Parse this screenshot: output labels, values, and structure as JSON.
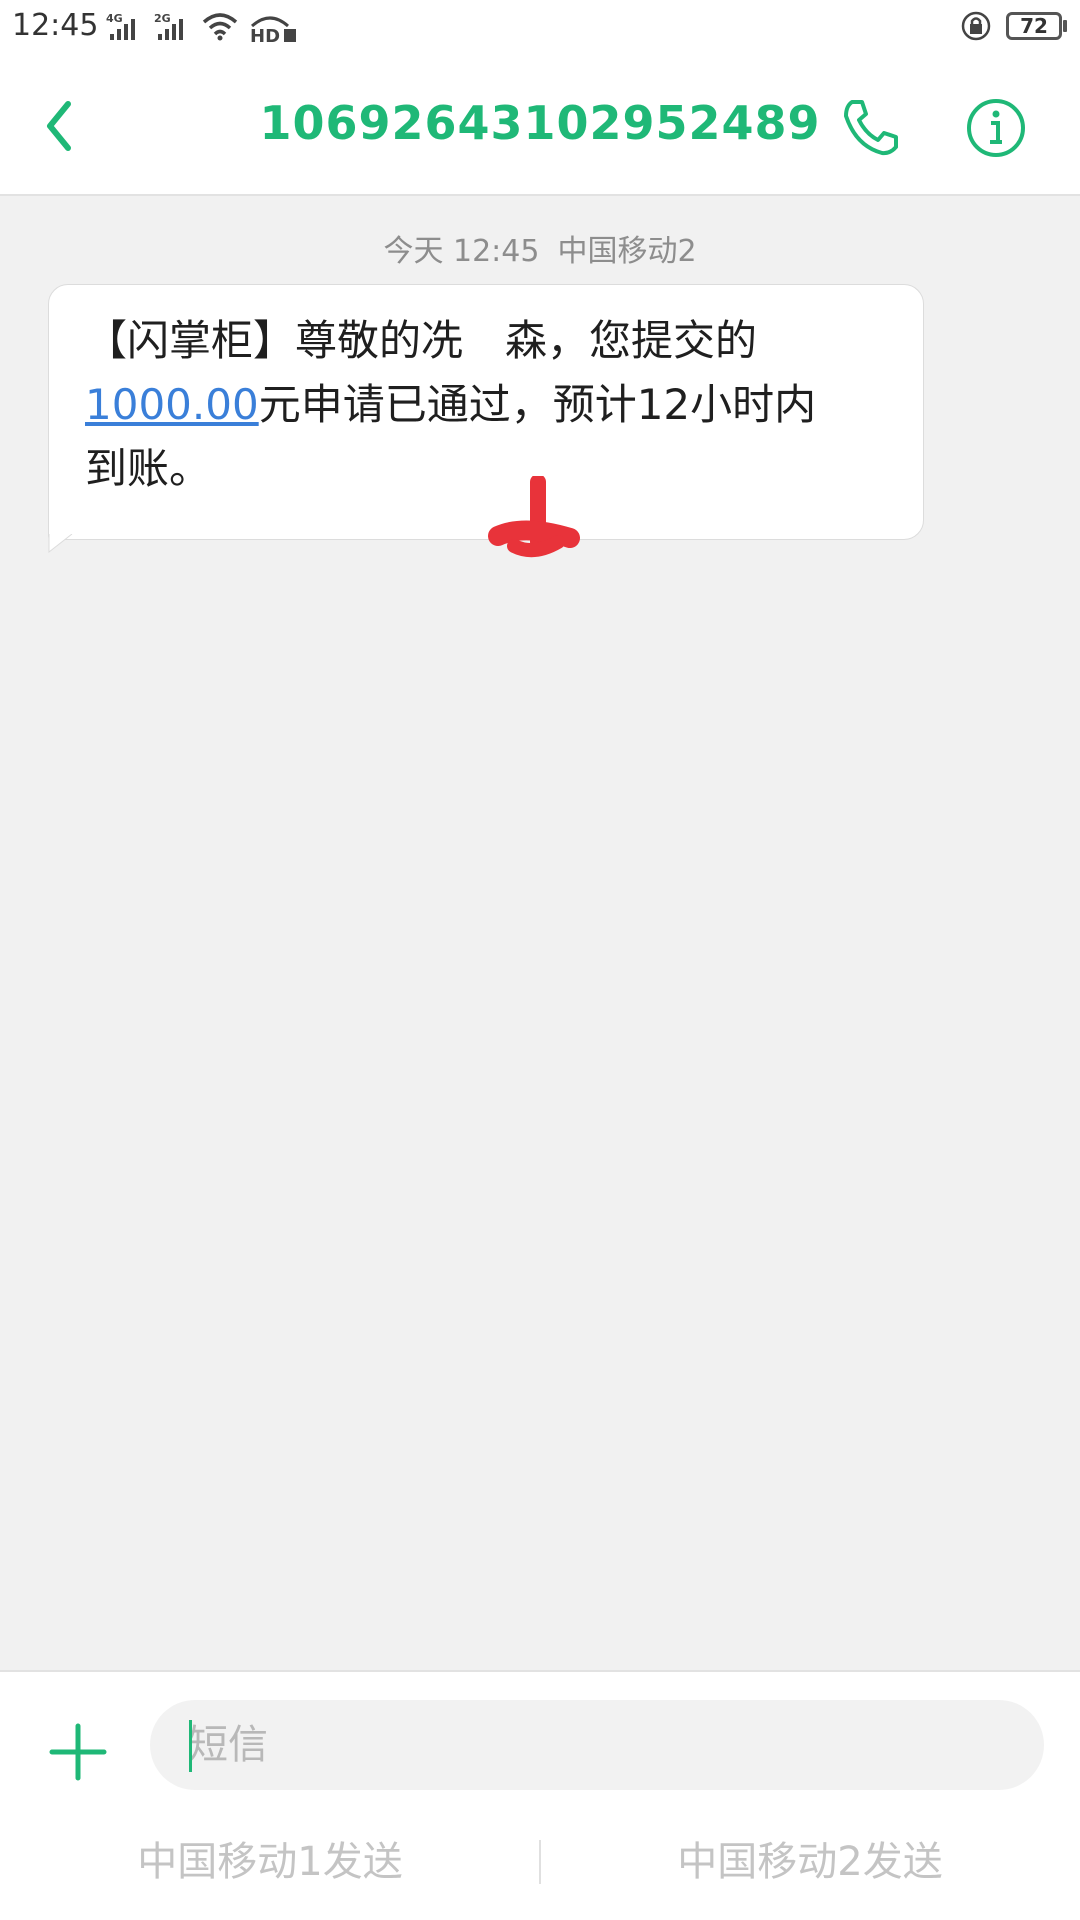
{
  "status_bar": {
    "time": "12:45",
    "sim1_network": "4G",
    "sim2_network": "2G",
    "hd_label": "HD",
    "battery": "72",
    "icons": [
      "signal-icon",
      "wifi-icon",
      "hd-call-icon",
      "rotation-lock-icon",
      "battery-icon"
    ]
  },
  "header": {
    "title": "10692643102952489",
    "icons": [
      "back-icon",
      "call-icon",
      "info-icon"
    ],
    "accent_color": "#1fb877"
  },
  "message": {
    "date": "今天 12:45",
    "carrier": "中国移动2",
    "text_line1": "【闪掌柜】尊敬的冼",
    "text_line1_tail": "森，您提交的",
    "amount": "1000.00",
    "text_after_amount": "元申请已通过，预计12小时内",
    "text_line3": "到账。",
    "link_color": "#3a7fd9"
  },
  "composer": {
    "placeholder": "短信",
    "send_sim1": "中国移动1发送",
    "send_sim2": "中国移动2发送"
  }
}
